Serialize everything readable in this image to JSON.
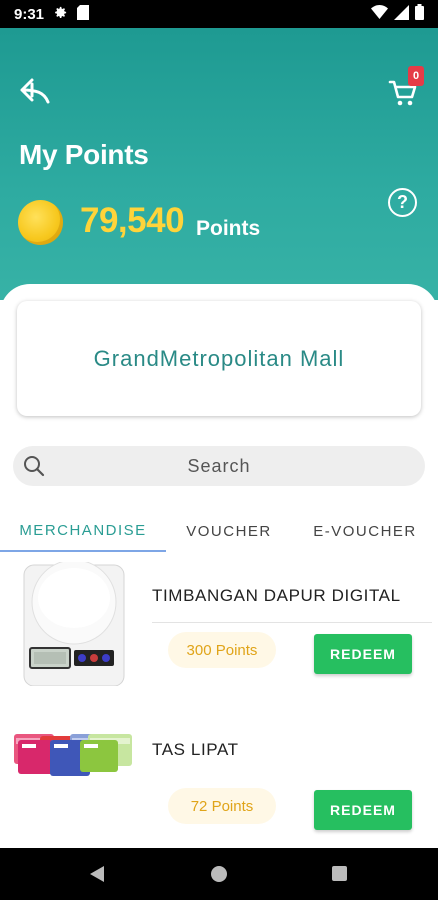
{
  "status_bar": {
    "time": "9:31",
    "icons": [
      "settings-icon",
      "sim-card-icon",
      "wifi-icon",
      "signal-icon",
      "battery-icon"
    ]
  },
  "header": {
    "title": "My Points",
    "points_value": "79,540",
    "points_unit": "Points",
    "cart_count": "0",
    "help_label": "?"
  },
  "mall": {
    "name": "GrandMetropolitan Mall"
  },
  "search": {
    "placeholder": "Search"
  },
  "tabs": [
    {
      "label": "MERCHANDISE",
      "active": true
    },
    {
      "label": "VOUCHER",
      "active": false
    },
    {
      "label": "E-VOUCHER",
      "active": false
    }
  ],
  "products": [
    {
      "name": "TIMBANGAN DAPUR DIGITAL",
      "points": "300 Points",
      "button": "REDEEM",
      "image": "digital-kitchen-scale"
    },
    {
      "name": "TAS LIPAT",
      "points": "72 Points",
      "button": "REDEEM",
      "image": "folding-bags"
    }
  ],
  "colors": {
    "header": "#2eaba1",
    "accent": "#2a9d94",
    "points_yellow": "#ffd43a",
    "redeem_green": "#26bf60",
    "badge_red": "#e53b47"
  }
}
